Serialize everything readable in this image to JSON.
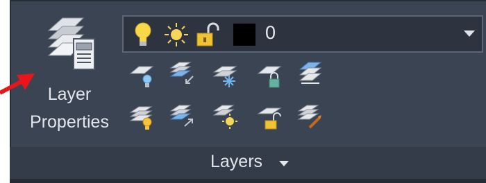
{
  "ribbon_panel": {
    "title": "Layers",
    "layer_properties_button": {
      "line1": "Layer",
      "line2": "Properties",
      "icon": "layer-stack-properties-icon"
    },
    "layer_control": {
      "current_layer": "0",
      "swatch_color": "#000000",
      "icons": [
        "bulb-icon",
        "sun-icon",
        "unlock-icon"
      ]
    },
    "tools_row1": [
      "layer-off-icon",
      "layer-unisolate-icon",
      "layer-freeze-icon",
      "layer-lock-icon",
      "layer-match-icon"
    ],
    "tools_row2": [
      "layer-on-icon",
      "layer-isolate-icon",
      "layer-thaw-icon",
      "layer-unlock-icon",
      "layer-make-current-icon"
    ]
  },
  "colors": {
    "panel_bg": "#3b4453",
    "footer_bg": "#343c4a",
    "text": "#e3e6ea",
    "accent_red": "#e8161b"
  }
}
